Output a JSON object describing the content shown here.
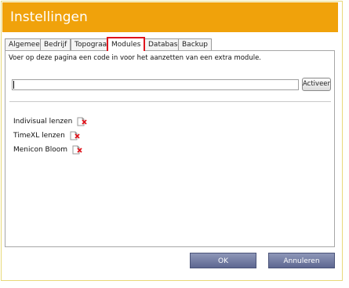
{
  "window": {
    "title": "Instellingen"
  },
  "tabs": [
    {
      "label": "Algemeen"
    },
    {
      "label": "Bedrijf"
    },
    {
      "label": "Topograaf"
    },
    {
      "label": "Modules",
      "active": true
    },
    {
      "label": "Database"
    },
    {
      "label": "Backup"
    }
  ],
  "modules_page": {
    "instruction": "Voer op deze pagina een code in voor het aanzetten van een extra module.",
    "code_input": {
      "value": "",
      "placeholder": ""
    },
    "activate_label": "Activeer",
    "modules": [
      {
        "name": "Indivisual lenzen",
        "icon": "delete-icon"
      },
      {
        "name": "TimeXL lenzen",
        "icon": "delete-icon"
      },
      {
        "name": "Menicon Bloom",
        "icon": "delete-icon"
      }
    ]
  },
  "footer": {
    "ok_label": "OK",
    "cancel_label": "Annuleren"
  },
  "colors": {
    "titlebar": "#f0a20b",
    "active_tab_outline": "#e0141c",
    "primary_button": "#6b7498"
  }
}
